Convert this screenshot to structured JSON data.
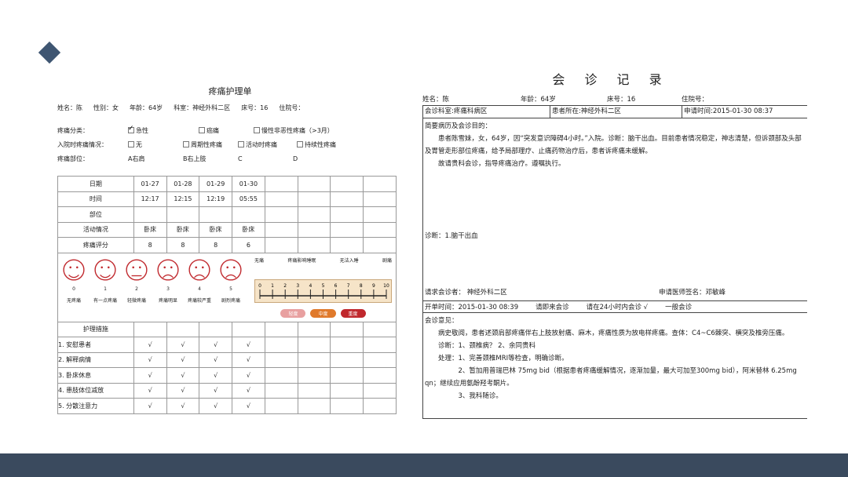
{
  "left_form": {
    "title": "疼痛护理单",
    "info": [
      "姓名：陈",
      "性别：女",
      "年龄：64岁",
      "科室：神经外科二区",
      "床号：16",
      "住院号："
    ],
    "category_label": "疼痛分类：",
    "category_opts": [
      "急性",
      "癌痛",
      "慢性非恶性疼痛（>3月）"
    ],
    "admission_label": "入院时疼痛情况：",
    "admission_opts": [
      "无",
      "周期性疼痛",
      "活动时疼痛",
      "持续性疼痛"
    ],
    "site_label": "疼痛部位：",
    "site_opts": [
      "A右肩",
      "B右上肢",
      "C",
      "D"
    ],
    "table": {
      "rows": [
        {
          "head": "日期",
          "cells": [
            "01-27",
            "01-28",
            "01-29",
            "01-30"
          ]
        },
        {
          "head": "时间",
          "cells": [
            "12:17",
            "12:15",
            "12:19",
            "05:55"
          ]
        },
        {
          "head": "部位",
          "cells": [
            "",
            "",
            "",
            ""
          ]
        },
        {
          "head": "活动情况",
          "cells": [
            "卧床",
            "卧床",
            "卧床",
            "卧床"
          ]
        },
        {
          "head": "疼痛评分",
          "cells": [
            "8",
            "8",
            "8",
            "6"
          ]
        }
      ],
      "faces": [
        {
          "num": "0",
          "label": "无疼痛"
        },
        {
          "num": "1",
          "label": "有一点疼痛"
        },
        {
          "num": "2",
          "label": "轻微疼痛"
        },
        {
          "num": "3",
          "label": "疼痛明显"
        },
        {
          "num": "4",
          "label": "疼痛较严重"
        },
        {
          "num": "5",
          "label": "剧烈疼痛"
        }
      ],
      "scale_labels": [
        "无痛",
        "疼痛影响睡眠",
        "无法入睡",
        "剧痛"
      ],
      "scale_pills": [
        "轻度",
        "中度",
        "重度"
      ],
      "measures_head": "护理措施",
      "measures": [
        {
          "head": "1. 安慰患者",
          "cells": [
            "√",
            "√",
            "√",
            "√"
          ]
        },
        {
          "head": "2. 解释病情",
          "cells": [
            "√",
            "√",
            "√",
            "√"
          ]
        },
        {
          "head": "3. 卧床休息",
          "cells": [
            "√",
            "√",
            "√",
            "√"
          ]
        },
        {
          "head": "4. 患肢体位减放",
          "cells": [
            "√",
            "√",
            "√",
            "√"
          ]
        },
        {
          "head": "5. 分散注意力",
          "cells": [
            "√",
            "√",
            "√",
            "√"
          ]
        }
      ]
    }
  },
  "consult": {
    "title": "会 诊 记 录",
    "info": [
      "姓名：陈",
      "年龄：64岁",
      "床号：16",
      "住院号："
    ],
    "dept": "会诊科室:疼痛科病区",
    "location": "患者所在:神经外科二区",
    "request_time": "申请时间:2015-01-30 08:37",
    "history_label": "简要病历及会诊目的：",
    "history_p1": "患者陈雪妹，女，64岁，因“突发意识障碍4小时。”入院。诊断：脑干出血。目前患者情况稳定，神志清楚，但诉颈部及头部及胃管走形部位疼痛，给予局部理疗、止痛药物治疗后，患者诉疼痛未缓解。",
    "history_p2": "故请贵科会诊，指导疼痛治疗。遵嘱执行。",
    "diagnosis": "诊断：1.脑干出血",
    "requester": "请求会诊者：    神经外科二区",
    "signature": "申请医师签名：邓敏峰",
    "order_time": "开单时间：2015-01-30 08:39",
    "opt1": "请即来会诊",
    "opt2": "请在24小时内会诊  √",
    "opt3": "一般会诊",
    "opinion_label": "会诊意见：",
    "op1": "病史敬阅，患者述颈肩部疼痛伴右上肢放射痛、麻木，疼痛性质为放电样疼痛。查体：C4~C6棘突、横突及椎旁压痛。",
    "op2": "诊断：1、颈椎病？  2、余同贵科",
    "op3": "处理：1、完善颈椎MRI等检查，明确诊断。",
    "op4": "2、暂加用普瑞巴林 75mg bid（根据患者疼痛缓解情况，逐渐加量，最大可加至300mg bid），阿米替林 6.25mg qn；继续应用氨酚羟考酮片。",
    "op5": "3、我科随诊。"
  }
}
